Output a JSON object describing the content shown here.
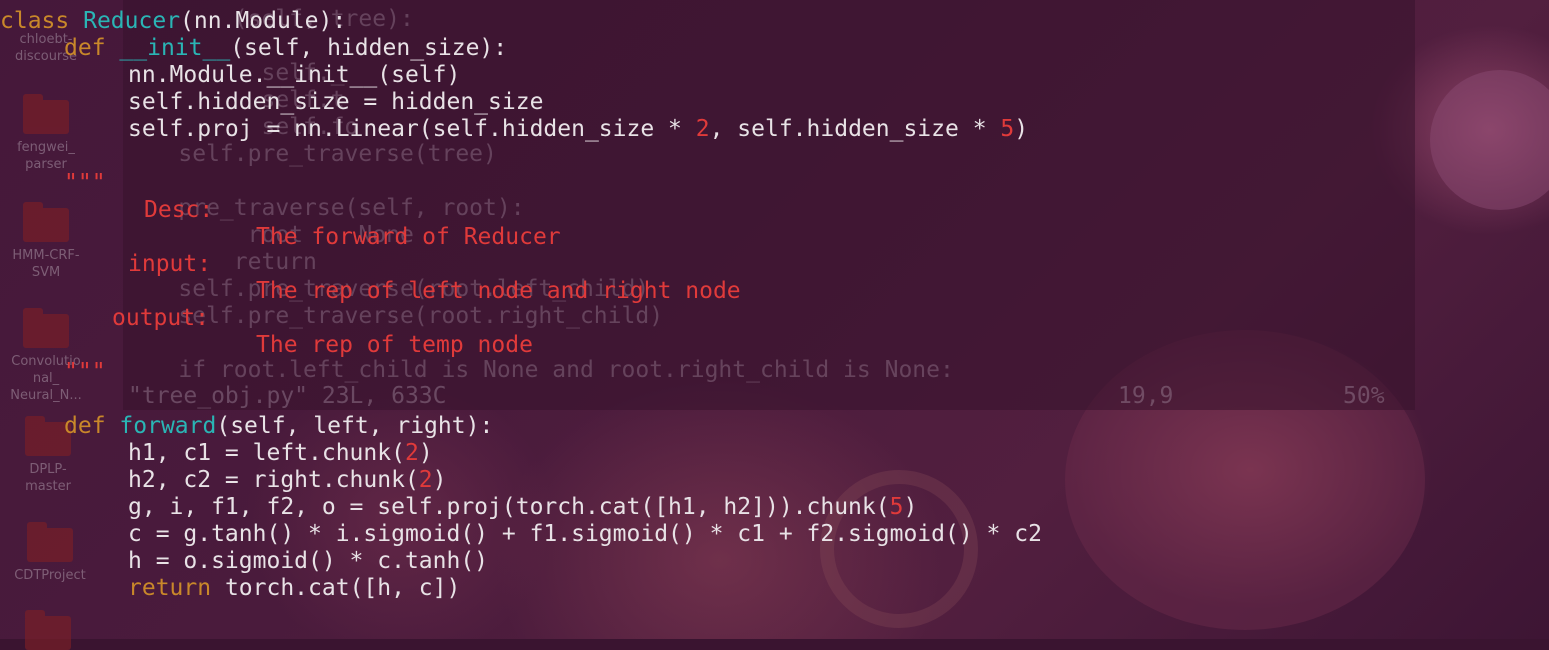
{
  "desktop": {
    "icons": [
      {
        "label": "chloebt-\ndiscourse"
      },
      {
        "label": "fengwei_\nparser"
      },
      {
        "label": "HMM-CRF-\nSVM"
      },
      {
        "label": "Convolutio\nnal_\nNeural_N..."
      },
      {
        "label": "DPLP-\nmaster"
      },
      {
        "label": "CDTProject"
      }
    ]
  },
  "background_terminal": {
    "lines": [
      "        (self, tree):",
      "",
      "          self._",
      "          self.t",
      "          self.fo",
      "    self.pre_traverse(tree)",
      "",
      "    pre_traverse(self, root):",
      "         root    None",
      "        return",
      "    self.pre_traverse(root.left_child)",
      "    self.pre_traverse(root.right_child)",
      "",
      "    if root.left_child is None and root.right_child is None:"
    ],
    "status_file": "\"tree_obj.py\" 23L, 633C",
    "status_pos": "19,9",
    "status_pct": "50%"
  },
  "code": {
    "l01_kw": "class",
    "l01_name": "Reducer",
    "l01_rest": "(nn.Module):",
    "l02_kw": "def",
    "l02_name": "__init__",
    "l02_rest": "(self, hidden_size):",
    "l03": "nn.Module.__init__(self)",
    "l04": "self.hidden_size = hidden_size",
    "l05_a": "self.proj = nn.Linear(self.hidden_size * ",
    "l05_n1": "2",
    "l05_b": ", self.hidden_size * ",
    "l05_n2": "5",
    "l05_c": ")",
    "doc_open": "\"\"\"",
    "doc_desc": "Desc:",
    "doc_desc_text": "The forward of Reducer",
    "doc_input": "input:",
    "doc_input_text": "The rep of left node and right node",
    "doc_output": "output:",
    "doc_output_text": "The rep of temp node",
    "doc_close": "\"\"\"",
    "l16_kw": "def",
    "l16_name": "forward",
    "l16_rest": "(self, left, right):",
    "l17_a": "h1, c1 = left.chunk(",
    "l17_n": "2",
    "l17_b": ")",
    "l18_a": "h2, c2 = right.chunk(",
    "l18_n": "2",
    "l18_b": ")",
    "l19_a": "g, i, f1, f2, o = self.proj(torch.cat([h1, h2])).chunk(",
    "l19_n": "5",
    "l19_b": ")",
    "l20": "c = g.tanh() * i.sigmoid() + f1.sigmoid() * c1 + f2.sigmoid() * c2",
    "l21": "h = o.sigmoid() * c.tanh()",
    "l22_kw": "return",
    "l22_rest": " torch.cat([h, c])"
  },
  "colors": {
    "keyword": "#c9882a",
    "class_name": "#2ab5b5",
    "number_string": "#e03a3a",
    "text": "#e8e2e6"
  }
}
